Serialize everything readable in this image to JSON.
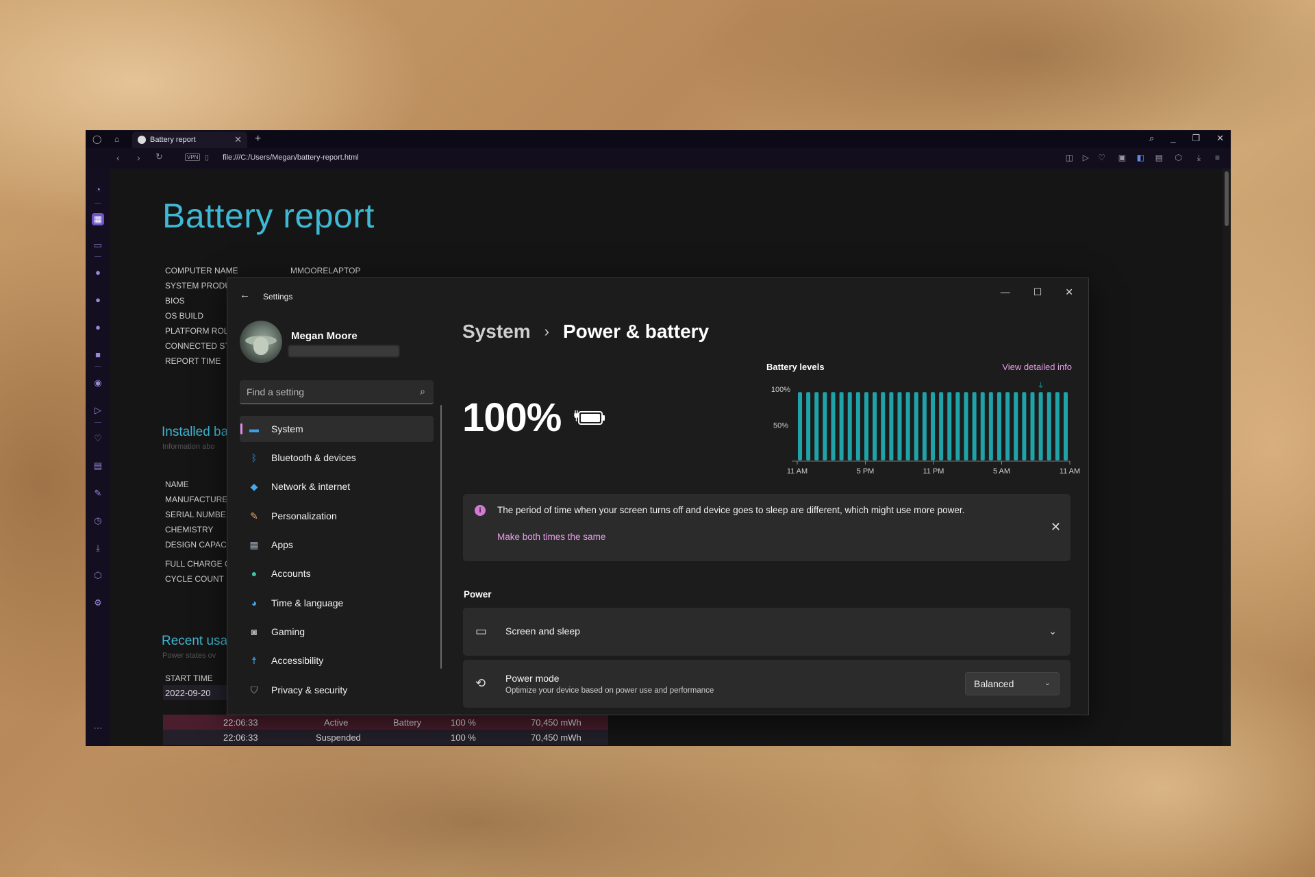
{
  "browser": {
    "tab_title": "Battery report",
    "url": "file:///C:/Users/Megan/battery-report.html",
    "vpn_label": "VPN",
    "new_tab_symbol": "+",
    "close_symbol": "✕"
  },
  "report": {
    "title": "Battery report",
    "system_labels": [
      "COMPUTER NAME",
      "SYSTEM PRODU",
      "BIOS",
      "OS BUILD",
      "PLATFORM ROL",
      "CONNECTED ST",
      "REPORT TIME"
    ],
    "computer_name": "MMOORELAPTOP",
    "installed_heading": "Installed ba",
    "installed_sub": "Information abo",
    "battery_labels": [
      "NAME",
      "MANUFACTURE",
      "SERIAL NUMBE",
      "CHEMISTRY",
      "DESIGN CAPAC",
      "FULL CHARGE C",
      "CYCLE COUNT"
    ],
    "recent_heading": "Recent usa",
    "recent_sub": "Power states ov",
    "start_time_label": "START TIME",
    "start_date": "2022-09-20",
    "rows": [
      {
        "time": "22:06:33",
        "state": "Active",
        "source": "Battery",
        "pct": "100 %",
        "capacity": "70,450 mWh"
      },
      {
        "time": "22:06:33",
        "state": "Suspended",
        "source": "",
        "pct": "100 %",
        "capacity": "70,450 mWh"
      }
    ]
  },
  "settings": {
    "window_title": "Settings",
    "user_name": "Megan Moore",
    "search_placeholder": "Find a setting",
    "nav": [
      {
        "label": "System",
        "icon": "system-monitor-icon",
        "color": "#3aa0e8"
      },
      {
        "label": "Bluetooth & devices",
        "icon": "bluetooth-icon",
        "color": "#2f8ee6"
      },
      {
        "label": "Network & internet",
        "icon": "wifi-icon",
        "color": "#4aa8e8"
      },
      {
        "label": "Personalization",
        "icon": "brush-icon",
        "color": "#e8a25c"
      },
      {
        "label": "Apps",
        "icon": "apps-icon",
        "color": "#9aa4b8"
      },
      {
        "label": "Accounts",
        "icon": "person-icon",
        "color": "#3ec4a4"
      },
      {
        "label": "Time & language",
        "icon": "globe-clock-icon",
        "color": "#4aa8e8"
      },
      {
        "label": "Gaming",
        "icon": "gamepad-icon",
        "color": "#b8b8b8"
      },
      {
        "label": "Accessibility",
        "icon": "accessibility-icon",
        "color": "#3a9de8"
      },
      {
        "label": "Privacy & security",
        "icon": "shield-icon",
        "color": "#b0b0b0"
      }
    ],
    "breadcrumb": {
      "parent": "System",
      "separator": "›",
      "current": "Power & battery"
    },
    "battery_percent": "100%",
    "chart_title": "Battery levels",
    "chart_link": "View detailed info",
    "info_message": "The period of time when your screen turns off and device goes to sleep are different, which might use more power.",
    "info_link": "Make both times the same",
    "power_section": "Power",
    "screen_sleep_label": "Screen and sleep",
    "power_mode_label": "Power mode",
    "power_mode_desc": "Optimize your device based on power use and performance",
    "power_mode_value": "Balanced",
    "accent_color": "#e89ce8",
    "bar_color": "#1fa3a8"
  },
  "chart_data": {
    "type": "bar",
    "title": "Battery levels",
    "y_ticks": [
      "100%",
      "50%"
    ],
    "x_ticks": [
      "11 AM",
      "5 PM",
      "11 PM",
      "5 AM",
      "11 AM"
    ],
    "ylim": [
      0,
      100
    ],
    "values": [
      96,
      96,
      96,
      96,
      96,
      96,
      96,
      96,
      96,
      96,
      96,
      96,
      96,
      96,
      96,
      96,
      96,
      96,
      96,
      96,
      96,
      96,
      96,
      96,
      96,
      96,
      96,
      96,
      96,
      96,
      96,
      96,
      96
    ],
    "grid": false
  }
}
